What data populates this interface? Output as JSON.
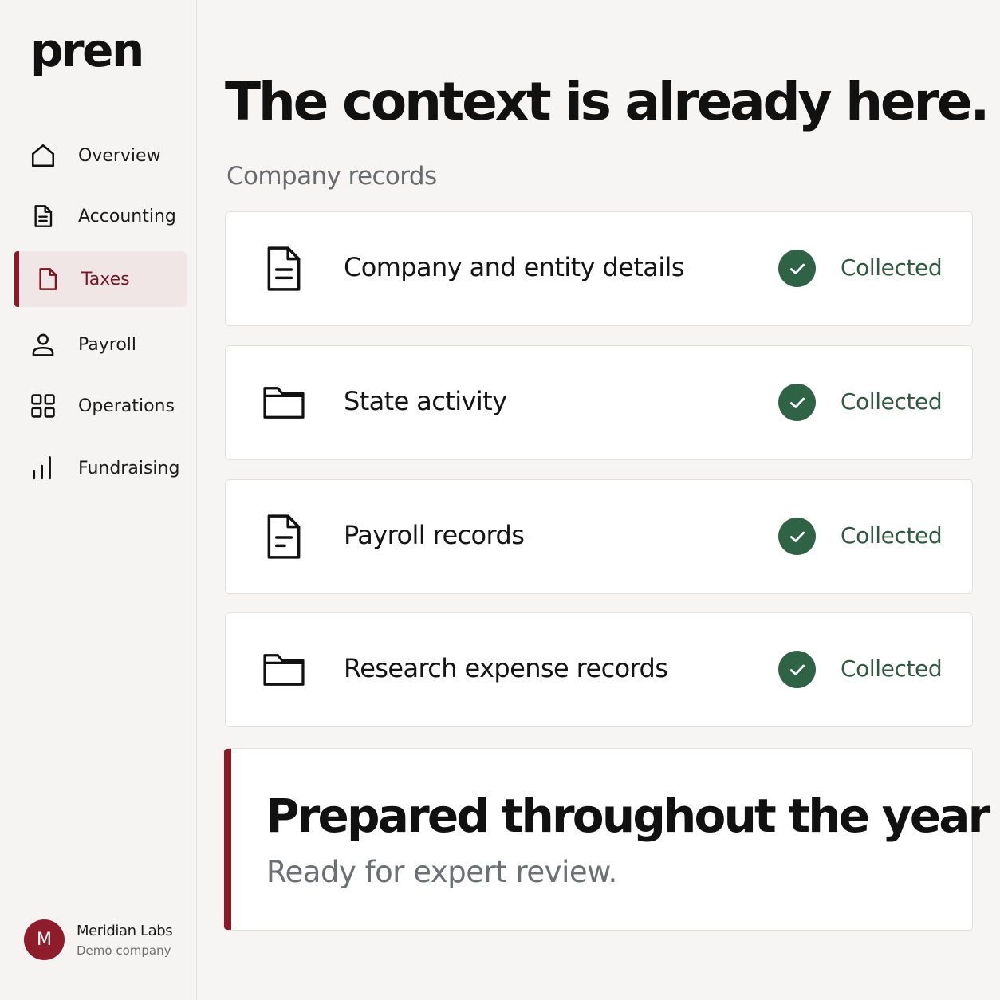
{
  "brand": {
    "logo": "pren"
  },
  "sidebar": {
    "items": [
      {
        "label": "Overview",
        "icon": "home-icon"
      },
      {
        "label": "Accounting",
        "icon": "document-icon"
      },
      {
        "label": "Taxes",
        "icon": "file-icon",
        "active": true
      },
      {
        "label": "Payroll",
        "icon": "user-icon"
      },
      {
        "label": "Operations",
        "icon": "grid-icon"
      },
      {
        "label": "Fundraising",
        "icon": "bar-chart-icon"
      }
    ],
    "user": {
      "initial": "M",
      "name": "Meridian Labs",
      "subtitle": "Demo company"
    }
  },
  "main": {
    "headline": "The context is already here.",
    "section_label": "Company records",
    "records": [
      {
        "title": "Company and entity details",
        "status": "Collected",
        "icon": "document-icon"
      },
      {
        "title": "State activity",
        "status": "Collected",
        "icon": "folder-icon"
      },
      {
        "title": "Payroll records",
        "status": "Collected",
        "icon": "document-icon"
      },
      {
        "title": "Research expense records",
        "status": "Collected",
        "icon": "folder-icon"
      }
    ],
    "callout": {
      "title": "Prepared throughout the year",
      "subtitle": "Ready for expert review."
    }
  },
  "colors": {
    "accent": "#8a1a28",
    "success": "#2e6345",
    "success_text": "#2f5a41",
    "active_bg": "#f1e6e6"
  }
}
